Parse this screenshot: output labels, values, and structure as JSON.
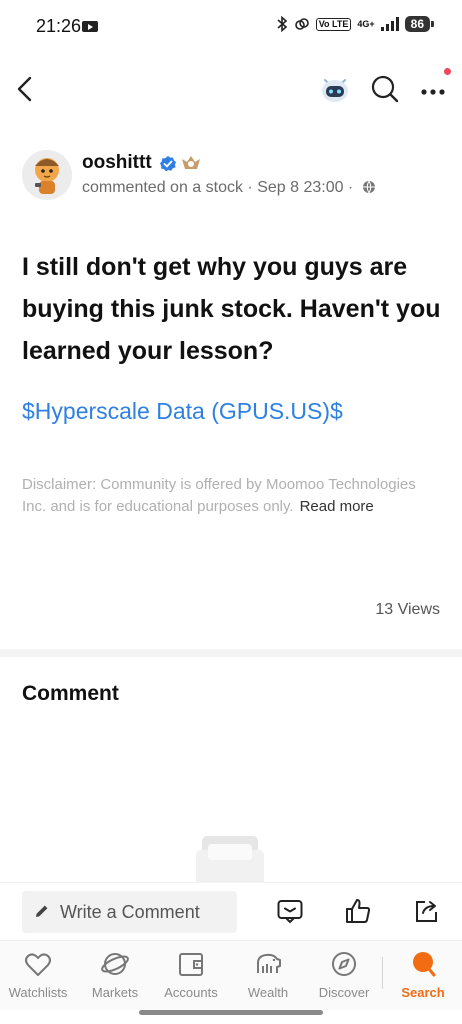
{
  "status_bar": {
    "time": "21:26",
    "network": "4G+",
    "volte": "Vo LTE",
    "battery": "86"
  },
  "author": {
    "name": "ooshittt",
    "meta": "commented on a stock · Sep 8 23:00 ·"
  },
  "post": {
    "text": "I still don't get why you guys are buying this junk stock. Haven't you learned your lesson?",
    "stock_link": "$Hyperscale Data (GPUS.US)$"
  },
  "disclaimer": {
    "text": "Disclaimer: Community is offered by Moomoo Technologies Inc. and is for educational purposes only.",
    "read_more": "Read more"
  },
  "views": "13 Views",
  "comment_section": {
    "heading": "Comment"
  },
  "comment_bar": {
    "placeholder": "Write a Comment"
  },
  "tab_bar": {
    "items": [
      {
        "label": "Watchlists",
        "icon": "heart-icon"
      },
      {
        "label": "Markets",
        "icon": "planet-icon"
      },
      {
        "label": "Accounts",
        "icon": "wallet-icon"
      },
      {
        "label": "Wealth",
        "icon": "piggy-bank-icon"
      },
      {
        "label": "Discover",
        "icon": "compass-icon"
      },
      {
        "label": "Search",
        "icon": "search-dot-icon",
        "active": true
      }
    ]
  },
  "colors": {
    "link": "#2f80e2",
    "active_tab": "#f26c14",
    "notification": "#f0475a",
    "verified": "#2f80e2"
  }
}
